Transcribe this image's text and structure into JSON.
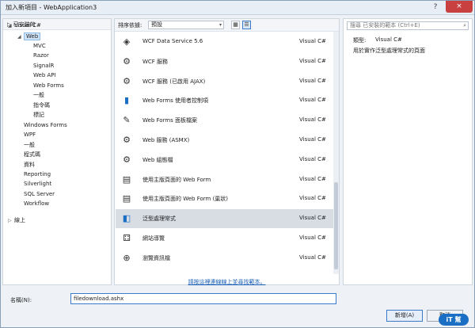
{
  "window": {
    "title": "加入新項目 - WebApplication3",
    "close_glyph": "×",
    "help_glyph": "?"
  },
  "tree": {
    "header": "▷ 已安裝的",
    "nodes": [
      {
        "label": "Visual C#",
        "arrow": "◢",
        "depth": 0
      },
      {
        "label": "Web",
        "arrow": "◢",
        "depth": 1,
        "selected": true
      },
      {
        "label": "MVC",
        "arrow": "",
        "depth": 2
      },
      {
        "label": "Razor",
        "arrow": "",
        "depth": 2
      },
      {
        "label": "SignalR",
        "arrow": "",
        "depth": 2
      },
      {
        "label": "Web API",
        "arrow": "",
        "depth": 2
      },
      {
        "label": "Web Forms",
        "arrow": "",
        "depth": 2
      },
      {
        "label": "一般",
        "arrow": "",
        "depth": 2
      },
      {
        "label": "指令碼",
        "arrow": "",
        "depth": 2
      },
      {
        "label": "標記",
        "arrow": "",
        "depth": 2
      },
      {
        "label": "Windows Forms",
        "arrow": "",
        "depth": 1
      },
      {
        "label": "WPF",
        "arrow": "",
        "depth": 1
      },
      {
        "label": "一般",
        "arrow": "",
        "depth": 1
      },
      {
        "label": "程式碼",
        "arrow": "",
        "depth": 1
      },
      {
        "label": "資料",
        "arrow": "",
        "depth": 1
      },
      {
        "label": "Reporting",
        "arrow": "",
        "depth": 1
      },
      {
        "label": "Silverlight",
        "arrow": "",
        "depth": 1
      },
      {
        "label": "SQL Server",
        "arrow": "",
        "depth": 1
      },
      {
        "label": "Workflow",
        "arrow": "",
        "depth": 1
      },
      {
        "label": "線上",
        "arrow": "▷",
        "depth": 0
      }
    ]
  },
  "toolbar": {
    "sort_label": "排序依據:",
    "sort_value": "預設",
    "dd_glyph": "▾",
    "grid_glyph": "▦",
    "list_glyph": "☰"
  },
  "items": [
    {
      "name": "WCF Data Service 5.6",
      "lang": "Visual C#",
      "icon": "wcf-data-icon",
      "glyph": "◈",
      "color": "#333333"
    },
    {
      "name": "WCF 服務",
      "lang": "Visual C#",
      "icon": "wcf-service-icon",
      "glyph": "⚙",
      "color": "#333333"
    },
    {
      "name": "WCF 服務 (已啟用 AJAX)",
      "lang": "Visual C#",
      "icon": "wcf-ajax-icon",
      "glyph": "⚙",
      "color": "#333333"
    },
    {
      "name": "Web Forms 使用者控制項",
      "lang": "Visual C#",
      "icon": "user-control-icon",
      "glyph": "▮",
      "color": "#1a6fc4"
    },
    {
      "name": "Web Forms 面板檔案",
      "lang": "Visual C#",
      "icon": "skin-file-icon",
      "glyph": "✎",
      "color": "#333333"
    },
    {
      "name": "Web 服務 (ASMX)",
      "lang": "Visual C#",
      "icon": "web-service-icon",
      "glyph": "⚙",
      "color": "#333333"
    },
    {
      "name": "Web 組態檔",
      "lang": "Visual C#",
      "icon": "web-config-icon",
      "glyph": "⚙",
      "color": "#333333"
    },
    {
      "name": "使用主版頁面的 Web Form",
      "lang": "Visual C#",
      "icon": "master-form-icon",
      "glyph": "▤",
      "color": "#333333"
    },
    {
      "name": "使用主版頁面的 Web Form (巢狀)",
      "lang": "Visual C#",
      "icon": "nested-master-icon",
      "glyph": "▤",
      "color": "#333333"
    },
    {
      "name": "泛型處理常式",
      "lang": "Visual C#",
      "icon": "generic-handler-icon",
      "glyph": "◧",
      "color": "#1a6fc4",
      "selected": true
    },
    {
      "name": "網站導覽",
      "lang": "Visual C#",
      "icon": "sitemap-icon",
      "glyph": "⚃",
      "color": "#333333"
    },
    {
      "name": "瀏覽資訊檔",
      "lang": "Visual C#",
      "icon": "browser-file-icon",
      "glyph": "⊕",
      "color": "#333333"
    }
  ],
  "online_link": "請按這裡連線線上並尋找範本。",
  "right_panel": {
    "search_placeholder": "搜尋 已安裝的範本 (Ctrl+E)",
    "search_glyph": "⌕",
    "type_label": "類型:",
    "type_value": "Visual C#",
    "description": "用於實作泛型處理常式的頁面"
  },
  "footer": {
    "name_label": "名稱(N):",
    "name_value": "filedownload.ashx",
    "add_label": "新增(A)",
    "cancel_label": "取消"
  },
  "logo": {
    "text": "iT 幫"
  }
}
